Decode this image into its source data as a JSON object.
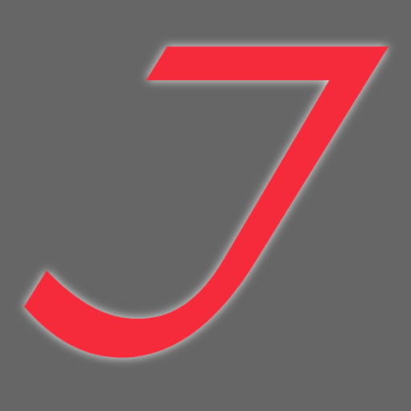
{
  "logo": {
    "icon": "stylized-j-logo-icon",
    "glyph": "J"
  },
  "colors": {
    "background": "#666666",
    "glyph_fill": "#f52a3a",
    "glow": "#f3f3f3"
  }
}
